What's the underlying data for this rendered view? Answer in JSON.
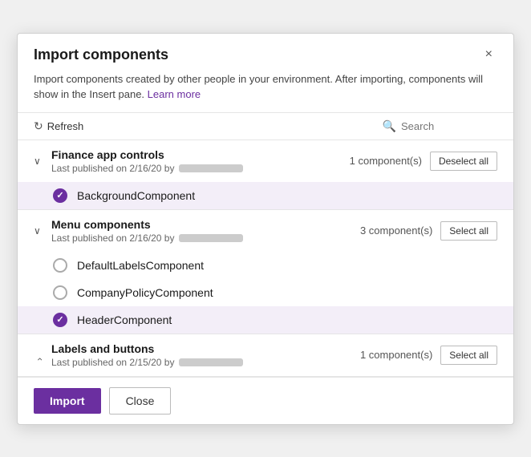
{
  "dialog": {
    "title": "Import components",
    "description": "Import components created by other people in your environment. After importing, components will show in the Insert pane.",
    "learn_more_label": "Learn more",
    "close_label": "×"
  },
  "toolbar": {
    "refresh_label": "Refresh",
    "search_placeholder": "Search"
  },
  "groups": [
    {
      "id": "finance",
      "name": "Finance app controls",
      "meta": "Last published on 2/16/20 by",
      "component_count": "1 component(s)",
      "expanded": true,
      "action_label": "Deselect all",
      "components": [
        {
          "name": "BackgroundComponent",
          "selected": true
        }
      ]
    },
    {
      "id": "menu",
      "name": "Menu components",
      "meta": "Last published on 2/16/20 by",
      "component_count": "3 component(s)",
      "expanded": true,
      "action_label": "Select all",
      "components": [
        {
          "name": "DefaultLabelsComponent",
          "selected": false
        },
        {
          "name": "CompanyPolicyComponent",
          "selected": false
        },
        {
          "name": "HeaderComponent",
          "selected": true
        }
      ]
    },
    {
      "id": "labels",
      "name": "Labels and buttons",
      "meta": "Last published on 2/15/20 by",
      "component_count": "1 component(s)",
      "expanded": false,
      "action_label": "Select all",
      "components": []
    }
  ],
  "footer": {
    "import_label": "Import",
    "close_label": "Close"
  },
  "colors": {
    "accent": "#6b2fa0",
    "selected_bg": "#f3eef8"
  }
}
